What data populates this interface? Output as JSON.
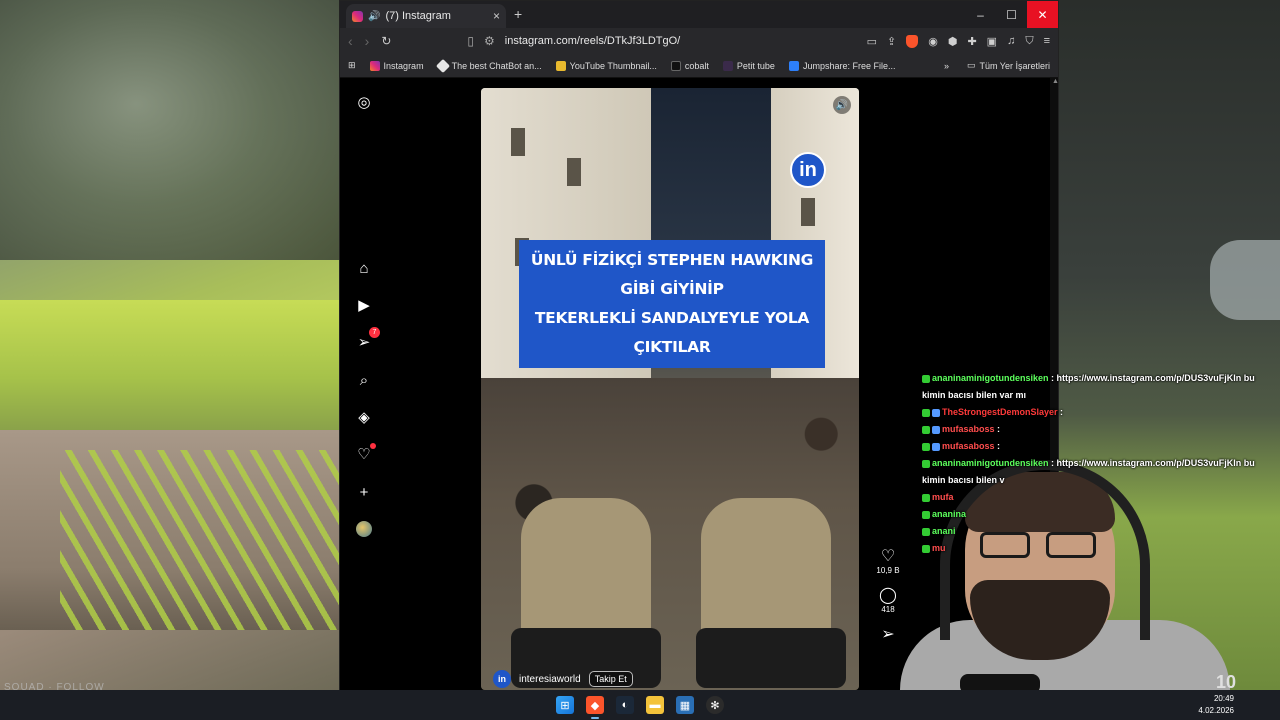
{
  "browser": {
    "tab_title": "(7) Instagram",
    "new_tab_label": "+",
    "url": "instagram.com/reels/DTkJf3LDTgO/",
    "bookmarks": [
      {
        "label": "Instagram"
      },
      {
        "label": "The best ChatBot an..."
      },
      {
        "label": "YouTube Thumbnail..."
      },
      {
        "label": "cobalt"
      },
      {
        "label": "Petit tube"
      },
      {
        "label": "Jumpshare: Free File..."
      }
    ],
    "bookmarks_overflow": "»",
    "all_bookmarks_label": "Tüm Yer İşaretleri",
    "minimize": "–",
    "maximize": "☐",
    "close": "✕"
  },
  "instagram": {
    "notifications_badge": "7",
    "reel": {
      "headline_line1": "ÜNLÜ FİZİKÇİ STEPHEN HAWKING GİBİ GİYİNİP",
      "headline_line2": "TEKERLEKLİ SANDALYEYLE YOLA ÇIKTILAR",
      "logo_text": "in",
      "username": "interesiaworld",
      "follow_label": "Takip Et",
      "avatar_text": "in"
    },
    "actions": {
      "likes": "10,9 B",
      "comments": "418"
    }
  },
  "chat": [
    {
      "user": "ananinaminigotundensiken",
      "text": " : https://www.instagram.com/p/DUS3vuFjKln bu kimin bacısı bilen var mı",
      "color": "#5cff5c"
    },
    {
      "user": "TheStrongestDemonSlayer",
      "text": " : ",
      "color": "#ff3a3a"
    },
    {
      "user": "mufasaboss",
      "text": " : ",
      "color": "#ff4d4d"
    },
    {
      "user": "mufasaboss",
      "text": " : ",
      "color": "#ff4d4d"
    },
    {
      "user": "ananinaminigotundensiken",
      "text": " : https://www.instagram.com/p/DUS3vuFjKln bu kimin bacısı bilen v",
      "color": "#5cff5c"
    },
    {
      "user": "mufa",
      "text": "",
      "color": "#ff4d4d"
    },
    {
      "user": "ananina",
      "text": "",
      "color": "#5cff5c"
    },
    {
      "user": "anani",
      "text": "",
      "color": "#5cff5c"
    },
    {
      "user": "mu",
      "text": "",
      "color": "#ff4d4d"
    }
  ],
  "overlay": {
    "squad_text": "SQUAD · FOLLOW",
    "level": "10"
  },
  "taskbar": {
    "time": "20:49",
    "date": "4.02.2026"
  }
}
